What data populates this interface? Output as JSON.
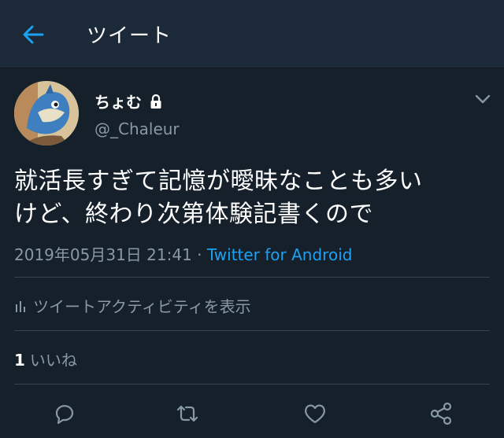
{
  "header": {
    "title": "ツイート"
  },
  "tweet": {
    "display_name": "ちょむ",
    "handle": "@_Chaleur",
    "text_line1": "就活長すぎて記憶が曖昧なことも多い",
    "text_line2": "けど、終わり次第体験記書くので",
    "datetime": "2019年05月31日 21:41",
    "separator": " · ",
    "source": "Twitter for Android"
  },
  "activity": {
    "label": "ツイートアクティビティを表示"
  },
  "stats": {
    "likes_count": "1",
    "likes_label": "いいね"
  },
  "colors": {
    "background": "#15202b",
    "header": "#1c2938",
    "accent": "#1da1f2",
    "muted": "#8899a6",
    "divider": "#38444d"
  },
  "icons": [
    "back-arrow-icon",
    "lock-icon",
    "chevron-down-icon",
    "bar-chart-icon",
    "reply-icon",
    "retweet-icon",
    "like-icon",
    "share-icon"
  ]
}
